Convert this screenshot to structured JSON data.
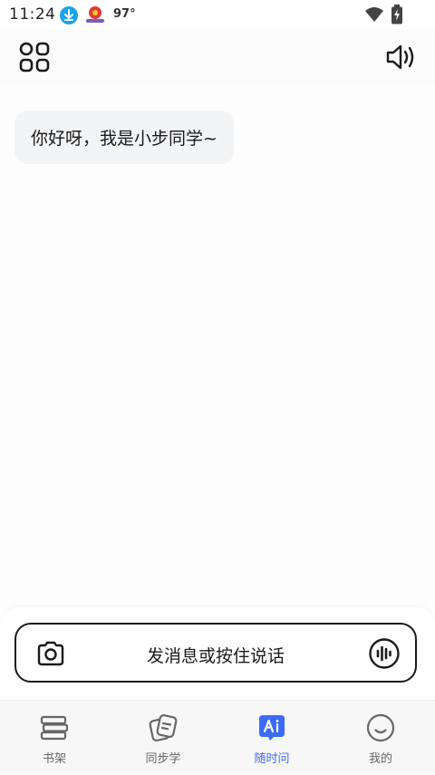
{
  "status_bar": {
    "time": "11:24",
    "temperature": "97°",
    "icons": [
      "download-icon",
      "notification-app-icon",
      "wifi-icon",
      "battery-charging-icon"
    ]
  },
  "header": {
    "left_icon": "apps-grid-icon",
    "right_icon": "speaker-icon"
  },
  "chat": {
    "messages": [
      {
        "from": "assistant",
        "text": "你好呀，我是小步同学~"
      }
    ]
  },
  "input": {
    "placeholder": "发消息或按住说话",
    "left_icon": "camera-icon",
    "right_icon": "voice-wave-icon"
  },
  "tabs": [
    {
      "label": "书架",
      "icon": "bookshelf-icon",
      "active": false
    },
    {
      "label": "同步学",
      "icon": "study-notes-icon",
      "active": false
    },
    {
      "label": "随时问",
      "icon": "ai-chat-icon",
      "active": true
    },
    {
      "label": "我的",
      "icon": "smile-profile-icon",
      "active": false
    }
  ],
  "colors": {
    "accent": "#3b6cf6",
    "bubble_bg": "#f3f4f6",
    "tab_bar_bg": "#f7f7f8"
  }
}
